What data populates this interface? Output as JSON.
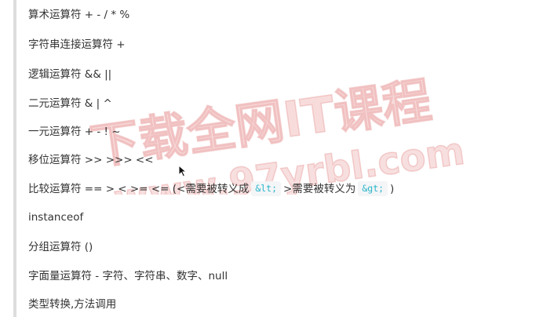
{
  "watermark": {
    "line1": "下载全网IT课程",
    "line2": "www.97yrbl.com"
  },
  "items": [
    {
      "text": "算术运算符 + - / * %"
    },
    {
      "text": "字符串连接运算符 +"
    },
    {
      "text": "逻辑运算符 && ||"
    },
    {
      "text": "二元运算符 & | ^"
    },
    {
      "text": "一元运算符 + - ! ~"
    },
    {
      "text": "移位运算符 >> >>> <<"
    },
    {
      "text": "比较运算符 == > < >= <= (<需要被转义成",
      "code1": "&lt;",
      "mid": ">需要被转义为",
      "code2": "&gt;",
      "end": ")"
    },
    {
      "text": "instanceof"
    },
    {
      "text": "分组运算符 ()"
    },
    {
      "text": "字面量运算符 - 字符、字符串、数字、null"
    },
    {
      "text": "类型转换,方法调用"
    }
  ]
}
